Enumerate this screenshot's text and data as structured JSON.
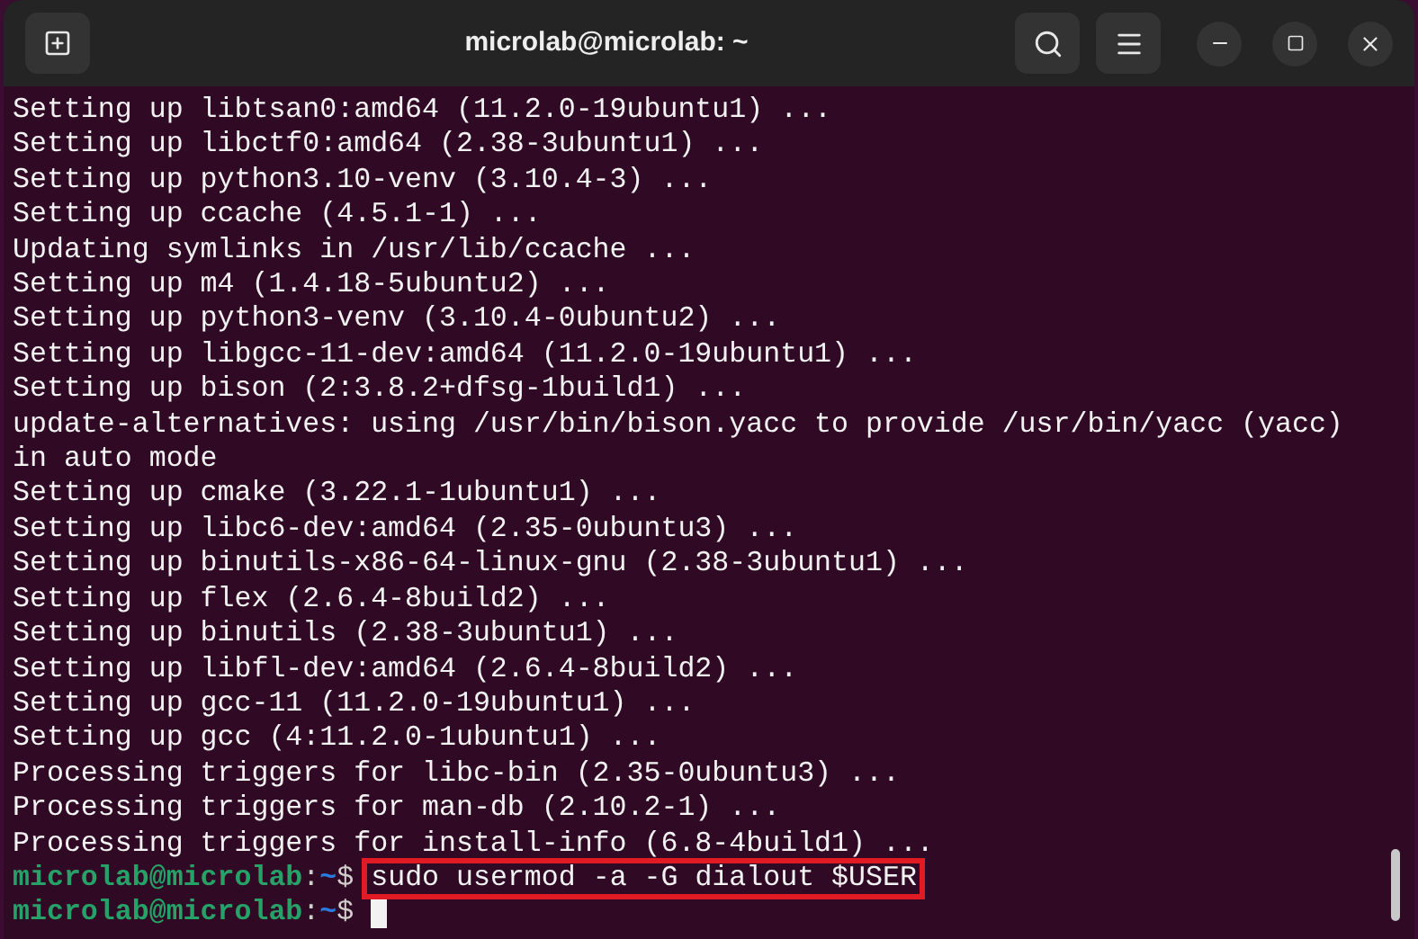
{
  "window": {
    "title": "microlab@microlab: ~"
  },
  "lines": [
    {
      "kind": "output",
      "text": "Setting up libtsan0:amd64 (11.2.0-19ubuntu1) ..."
    },
    {
      "kind": "output",
      "text": "Setting up libctf0:amd64 (2.38-3ubuntu1) ..."
    },
    {
      "kind": "output",
      "text": "Setting up python3.10-venv (3.10.4-3) ..."
    },
    {
      "kind": "output",
      "text": "Setting up ccache (4.5.1-1) ..."
    },
    {
      "kind": "output",
      "text": "Updating symlinks in /usr/lib/ccache ..."
    },
    {
      "kind": "output",
      "text": "Setting up m4 (1.4.18-5ubuntu2) ..."
    },
    {
      "kind": "output",
      "text": "Setting up python3-venv (3.10.4-0ubuntu2) ..."
    },
    {
      "kind": "output",
      "text": "Setting up libgcc-11-dev:amd64 (11.2.0-19ubuntu1) ..."
    },
    {
      "kind": "output",
      "text": "Setting up bison (2:3.8.2+dfsg-1build1) ..."
    },
    {
      "kind": "output",
      "text": "update-alternatives: using /usr/bin/bison.yacc to provide /usr/bin/yacc (yacc)"
    },
    {
      "kind": "output",
      "text": "in auto mode"
    },
    {
      "kind": "output",
      "text": "Setting up cmake (3.22.1-1ubuntu1) ..."
    },
    {
      "kind": "output",
      "text": "Setting up libc6-dev:amd64 (2.35-0ubuntu3) ..."
    },
    {
      "kind": "output",
      "text": "Setting up binutils-x86-64-linux-gnu (2.38-3ubuntu1) ..."
    },
    {
      "kind": "output",
      "text": "Setting up flex (2.6.4-8build2) ..."
    },
    {
      "kind": "output",
      "text": "Setting up binutils (2.38-3ubuntu1) ..."
    },
    {
      "kind": "output",
      "text": "Setting up libfl-dev:amd64 (2.6.4-8build2) ..."
    },
    {
      "kind": "output",
      "text": "Setting up gcc-11 (11.2.0-19ubuntu1) ..."
    },
    {
      "kind": "output",
      "text": "Setting up gcc (4:11.2.0-1ubuntu1) ..."
    },
    {
      "kind": "output",
      "text": "Processing triggers for libc-bin (2.35-0ubuntu3) ..."
    },
    {
      "kind": "output",
      "text": "Processing triggers for man-db (2.10.2-1) ..."
    },
    {
      "kind": "output",
      "text": "Processing triggers for install-info (6.8-4build1) ..."
    },
    {
      "kind": "prompt",
      "user": "microlab@microlab",
      "separator": ":",
      "path": "~",
      "sigil": "$",
      "command": "sudo usermod -a -G dialout $USER",
      "highlighted": true,
      "cursor": false
    },
    {
      "kind": "prompt",
      "user": "microlab@microlab",
      "separator": ":",
      "path": "~",
      "sigil": "$",
      "cursor": true
    }
  ]
}
